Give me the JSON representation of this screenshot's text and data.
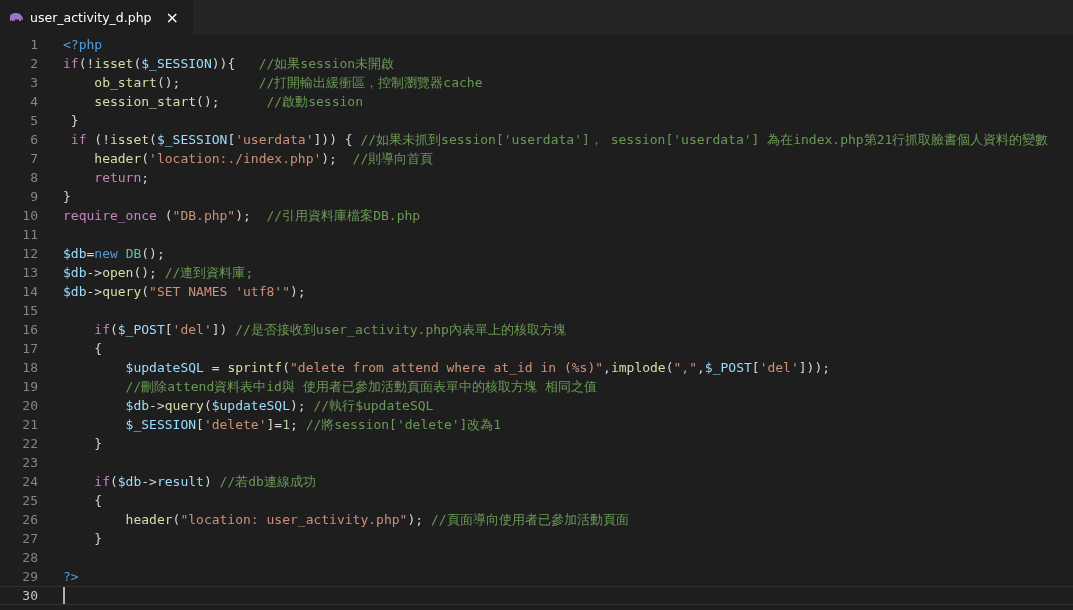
{
  "tabs": [
    {
      "label": "user_activity_d.php",
      "close": "×",
      "selected": true
    }
  ],
  "editor": {
    "lines": [
      {
        "n": "1",
        "current": false,
        "tokens": [
          {
            "kind": "tag",
            "text": "<?php"
          }
        ]
      },
      {
        "n": "2",
        "current": false,
        "tokens": [
          {
            "kind": "kw",
            "text": "if"
          },
          {
            "kind": "plain",
            "text": "(!"
          },
          {
            "kind": "func",
            "text": "isset"
          },
          {
            "kind": "plain",
            "text": "("
          },
          {
            "kind": "var",
            "text": "$_SESSION"
          },
          {
            "kind": "plain",
            "text": ")){   "
          },
          {
            "kind": "comment",
            "text": "//如果session未開啟"
          }
        ]
      },
      {
        "n": "3",
        "current": false,
        "tokens": [
          {
            "kind": "func",
            "text": "    ob_start"
          },
          {
            "kind": "plain",
            "text": "();          "
          },
          {
            "kind": "comment",
            "text": "//打開輸出緩衝區，控制瀏覽器cache"
          }
        ]
      },
      {
        "n": "4",
        "current": false,
        "tokens": [
          {
            "kind": "func",
            "text": "    session_start"
          },
          {
            "kind": "plain",
            "text": "();      "
          },
          {
            "kind": "comment",
            "text": "//啟動session"
          }
        ]
      },
      {
        "n": "5",
        "current": false,
        "tokens": [
          {
            "kind": "plain",
            "text": " }"
          }
        ]
      },
      {
        "n": "6",
        "current": false,
        "tokens": [
          {
            "kind": "kw",
            "text": " if"
          },
          {
            "kind": "plain",
            "text": " (!"
          },
          {
            "kind": "func",
            "text": "isset"
          },
          {
            "kind": "plain",
            "text": "("
          },
          {
            "kind": "var",
            "text": "$_SESSION"
          },
          {
            "kind": "plain",
            "text": "["
          },
          {
            "kind": "string",
            "text": "'userdata'"
          },
          {
            "kind": "plain",
            "text": "])) { "
          },
          {
            "kind": "comment",
            "text": "//如果未抓到session['userdata']， session['userdata'] 為在index.php第21行抓取臉書個人資料的變數"
          }
        ]
      },
      {
        "n": "7",
        "current": false,
        "tokens": [
          {
            "kind": "func",
            "text": "    header"
          },
          {
            "kind": "plain",
            "text": "("
          },
          {
            "kind": "string",
            "text": "'location:./index.php'"
          },
          {
            "kind": "plain",
            "text": ");  "
          },
          {
            "kind": "comment",
            "text": "//則導向首頁"
          }
        ]
      },
      {
        "n": "8",
        "current": false,
        "tokens": [
          {
            "kind": "kw",
            "text": "    return"
          },
          {
            "kind": "plain",
            "text": ";"
          }
        ]
      },
      {
        "n": "9",
        "current": false,
        "tokens": [
          {
            "kind": "plain",
            "text": "}"
          }
        ]
      },
      {
        "n": "10",
        "current": false,
        "tokens": [
          {
            "kind": "kw",
            "text": "require_once"
          },
          {
            "kind": "plain",
            "text": " ("
          },
          {
            "kind": "string",
            "text": "\"DB.php\""
          },
          {
            "kind": "plain",
            "text": ");  "
          },
          {
            "kind": "comment",
            "text": "//引用資料庫檔案DB.php"
          }
        ]
      },
      {
        "n": "11",
        "current": false
      },
      {
        "n": "12",
        "current": false,
        "tokens": [
          {
            "kind": "var",
            "text": "$db"
          },
          {
            "kind": "plain",
            "text": "="
          },
          {
            "kind": "tag",
            "text": "new "
          },
          {
            "kind": "cls",
            "text": "DB"
          },
          {
            "kind": "plain",
            "text": "();"
          }
        ]
      },
      {
        "n": "13",
        "current": false,
        "tokens": [
          {
            "kind": "var",
            "text": "$db"
          },
          {
            "kind": "plain",
            "text": "->"
          },
          {
            "kind": "func",
            "text": "open"
          },
          {
            "kind": "plain",
            "text": "(); "
          },
          {
            "kind": "comment",
            "text": "//連到資料庫;"
          }
        ]
      },
      {
        "n": "14",
        "current": false,
        "tokens": [
          {
            "kind": "var",
            "text": "$db"
          },
          {
            "kind": "plain",
            "text": "->"
          },
          {
            "kind": "func",
            "text": "query"
          },
          {
            "kind": "plain",
            "text": "("
          },
          {
            "kind": "string",
            "text": "\"SET NAMES 'utf8'\""
          },
          {
            "kind": "plain",
            "text": ");"
          }
        ]
      },
      {
        "n": "15",
        "current": false
      },
      {
        "n": "16",
        "current": false,
        "tokens": [
          {
            "kind": "kw",
            "text": "    if"
          },
          {
            "kind": "plain",
            "text": "("
          },
          {
            "kind": "var",
            "text": "$_POST"
          },
          {
            "kind": "plain",
            "text": "["
          },
          {
            "kind": "string",
            "text": "'del'"
          },
          {
            "kind": "plain",
            "text": "]) "
          },
          {
            "kind": "comment",
            "text": "//是否接收到user_activity.php內表單上的核取方塊"
          }
        ]
      },
      {
        "n": "17",
        "current": false,
        "tokens": [
          {
            "kind": "plain",
            "text": "    {"
          }
        ]
      },
      {
        "n": "18",
        "current": false,
        "tokens": [
          {
            "kind": "var",
            "text": "        $updateSQL"
          },
          {
            "kind": "plain",
            "text": " = "
          },
          {
            "kind": "func",
            "text": "sprintf"
          },
          {
            "kind": "plain",
            "text": "("
          },
          {
            "kind": "string",
            "text": "\"delete from attend where at_id in (%s)\""
          },
          {
            "kind": "plain",
            "text": ","
          },
          {
            "kind": "func",
            "text": "implode"
          },
          {
            "kind": "plain",
            "text": "("
          },
          {
            "kind": "string",
            "text": "\",\""
          },
          {
            "kind": "plain",
            "text": ","
          },
          {
            "kind": "var",
            "text": "$_POST"
          },
          {
            "kind": "plain",
            "text": "["
          },
          {
            "kind": "string",
            "text": "'del'"
          },
          {
            "kind": "plain",
            "text": "]));"
          }
        ]
      },
      {
        "n": "19",
        "current": false,
        "tokens": [
          {
            "kind": "comment",
            "text": "        //刪除attend資料表中id與 使用者已參加活動頁面表單中的核取方塊 相同之值"
          }
        ]
      },
      {
        "n": "20",
        "current": false,
        "tokens": [
          {
            "kind": "var",
            "text": "        $db"
          },
          {
            "kind": "plain",
            "text": "->"
          },
          {
            "kind": "func",
            "text": "query"
          },
          {
            "kind": "plain",
            "text": "("
          },
          {
            "kind": "var",
            "text": "$updateSQL"
          },
          {
            "kind": "plain",
            "text": "); "
          },
          {
            "kind": "comment",
            "text": "//執行$updateSQL"
          }
        ]
      },
      {
        "n": "21",
        "current": false,
        "tokens": [
          {
            "kind": "var",
            "text": "        $_SESSION"
          },
          {
            "kind": "plain",
            "text": "["
          },
          {
            "kind": "string",
            "text": "'delete'"
          },
          {
            "kind": "plain",
            "text": "]="
          },
          {
            "kind": "num",
            "text": "1"
          },
          {
            "kind": "plain",
            "text": "; "
          },
          {
            "kind": "comment",
            "text": "//將session['delete']改為1"
          }
        ]
      },
      {
        "n": "22",
        "current": false,
        "tokens": [
          {
            "kind": "plain",
            "text": "    }"
          }
        ]
      },
      {
        "n": "23",
        "current": false
      },
      {
        "n": "24",
        "current": false,
        "tokens": [
          {
            "kind": "kw",
            "text": "    if"
          },
          {
            "kind": "plain",
            "text": "("
          },
          {
            "kind": "var",
            "text": "$db"
          },
          {
            "kind": "plain",
            "text": "->"
          },
          {
            "kind": "var",
            "text": "result"
          },
          {
            "kind": "plain",
            "text": ") "
          },
          {
            "kind": "comment",
            "text": "//若db連線成功"
          }
        ]
      },
      {
        "n": "25",
        "current": false,
        "tokens": [
          {
            "kind": "plain",
            "text": "    {"
          }
        ]
      },
      {
        "n": "26",
        "current": false,
        "tokens": [
          {
            "kind": "func",
            "text": "        header"
          },
          {
            "kind": "plain",
            "text": "("
          },
          {
            "kind": "string",
            "text": "\"location: user_activity.php\""
          },
          {
            "kind": "plain",
            "text": "); "
          },
          {
            "kind": "comment",
            "text": "//頁面導向使用者已參加活動頁面"
          }
        ]
      },
      {
        "n": "27",
        "current": false,
        "tokens": [
          {
            "kind": "plain",
            "text": "    }"
          }
        ]
      },
      {
        "n": "28",
        "current": false
      },
      {
        "n": "29",
        "current": false,
        "tokens": [
          {
            "kind": "tag",
            "text": "?>"
          }
        ]
      },
      {
        "n": "30",
        "current": true
      }
    ]
  }
}
